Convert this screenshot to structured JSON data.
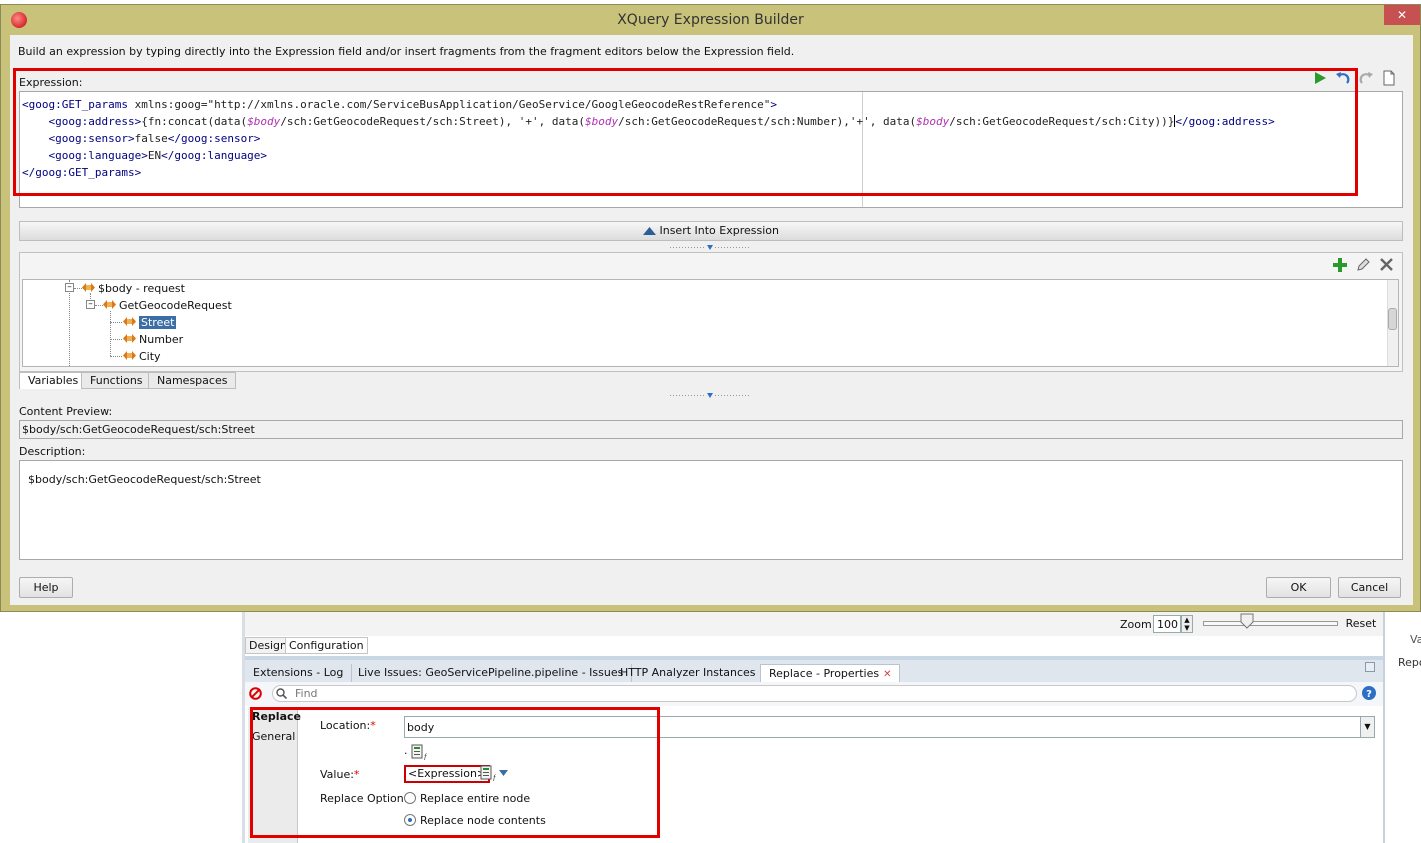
{
  "dialog": {
    "title": "XQuery Expression Builder",
    "instruction": "Build an expression by typing directly into the Expression field and/or insert fragments from the fragment editors below the Expression field.",
    "expression_label": "Expression:",
    "expression_lines": [
      [
        {
          "t": "tag",
          "v": "<goog:GET_params "
        },
        {
          "t": "txt",
          "v": "xmlns:goog=\"http://xmlns.oracle.com/ServiceBusApplication/GeoService/GoogleGeocodeRestReference\""
        },
        {
          "t": "tag",
          "v": ">"
        }
      ],
      [
        {
          "t": "tag",
          "v": "    <goog:address>"
        },
        {
          "t": "txt",
          "v": "{fn:concat(data("
        },
        {
          "t": "var",
          "v": "$body"
        },
        {
          "t": "txt",
          "v": "/sch:GetGeocodeRequest/sch:Street), '+', data("
        },
        {
          "t": "var",
          "v": "$body"
        },
        {
          "t": "txt",
          "v": "/sch:GetGeocodeRequest/sch:Number),'+', data("
        },
        {
          "t": "var",
          "v": "$body"
        },
        {
          "t": "txt",
          "v": "/sch:GetGeocodeRequest/sch:City))}"
        },
        {
          "t": "caret",
          "v": ""
        },
        {
          "t": "tag",
          "v": "</goog:address>"
        }
      ],
      [
        {
          "t": "tag",
          "v": "    <goog:sensor>"
        },
        {
          "t": "txt",
          "v": "false"
        },
        {
          "t": "tag",
          "v": "</goog:sensor>"
        }
      ],
      [
        {
          "t": "tag",
          "v": "    <goog:language>"
        },
        {
          "t": "txt",
          "v": "EN"
        },
        {
          "t": "tag",
          "v": "</goog:language>"
        }
      ],
      [
        {
          "t": "tag",
          "v": "</goog:GET_params>"
        }
      ]
    ],
    "insert_label": "Insert Into Expression",
    "tree": {
      "root": "$body - request",
      "child": "GetGeocodeRequest",
      "leaves": [
        "Street",
        "Number",
        "City"
      ],
      "selected": "Street"
    },
    "fragment_tabs": [
      "Variables",
      "Functions",
      "Namespaces"
    ],
    "content_preview_label": "Content Preview:",
    "content_preview": "$body/sch:GetGeocodeRequest/sch:Street",
    "description_label": "Description:",
    "description": "$body/sch:GetGeocodeRequest/sch:Street",
    "help_label": "Help",
    "ok_label": "OK",
    "cancel_label": "Cancel",
    "close_glyph": "✕"
  },
  "ide": {
    "zoom_label": "Zoom:",
    "zoom_value": "100",
    "reset_label": "Reset",
    "design_tab": "Design",
    "configuration_tab": "Configuration",
    "bottom_tabs": [
      "Extensions - Log",
      "Live Issues: GeoServicePipeline.pipeline - Issues",
      "HTTP Analyzer Instances",
      "Replace - Properties"
    ],
    "find_placeholder": "Find",
    "side_items": [
      "Replace",
      "General"
    ],
    "location_label": "Location:",
    "location_value": "body",
    "value_label": "Value:",
    "value_expression": "<Expression>",
    "replace_option_label": "Replace Option:",
    "radio_entire": "Replace entire node",
    "radio_contents": "Replace node contents",
    "required_mark": "*",
    "right_fragment_1": "Va",
    "right_fragment_2": "Repo",
    "dot": "."
  },
  "colors": {
    "dialog_frame": "#c9c27a",
    "highlight": "#e00000",
    "selection": "#3a6ea5"
  }
}
